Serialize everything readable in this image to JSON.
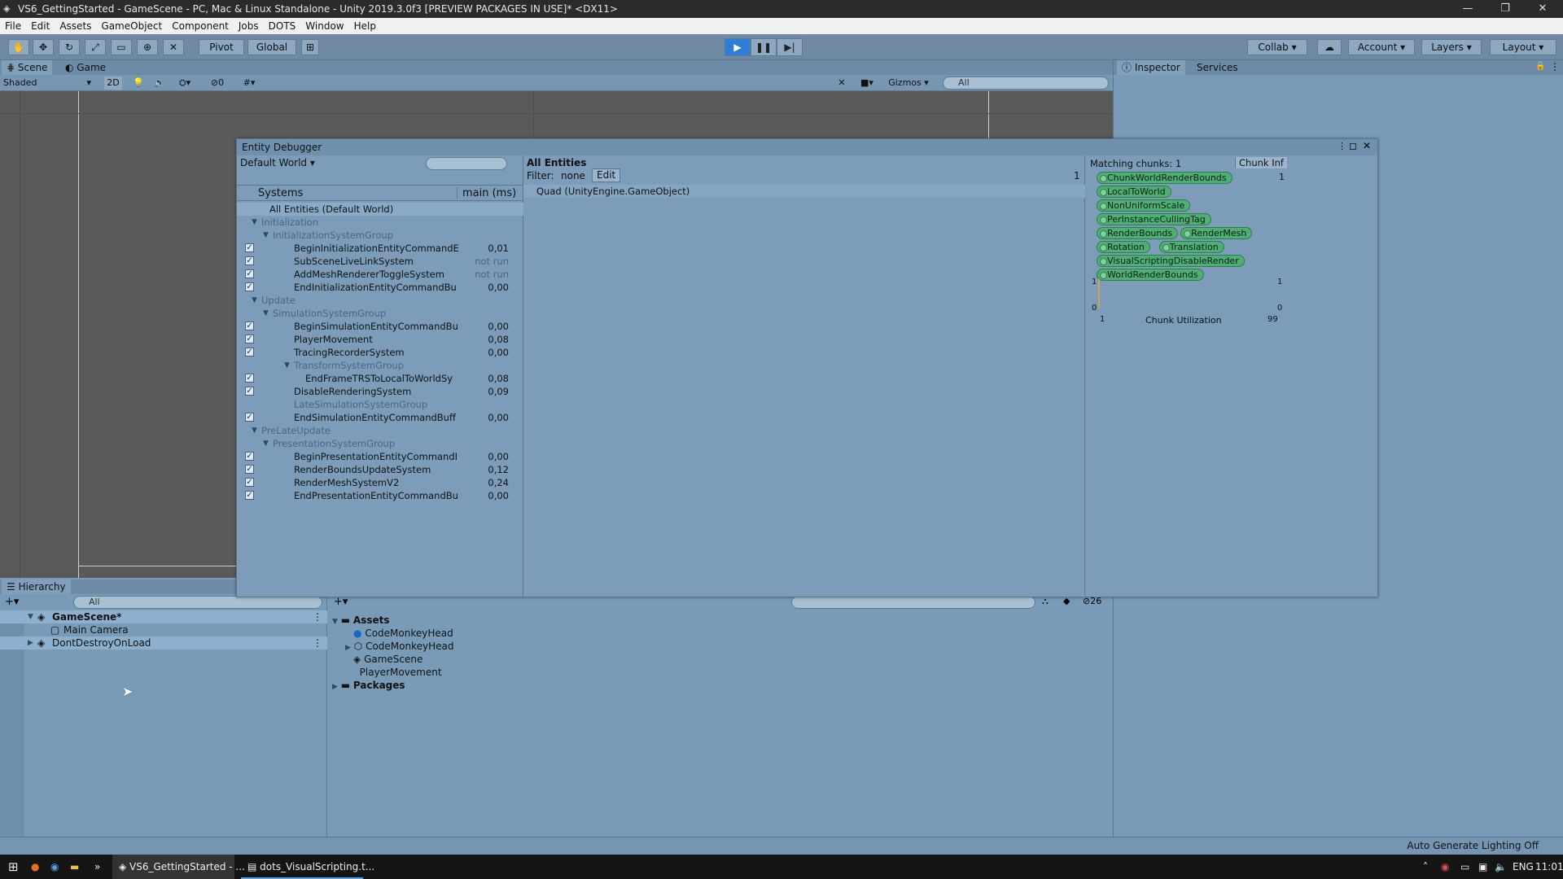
{
  "window": {
    "title": "VS6_GettingStarted - GameScene - PC, Mac & Linux Standalone - Unity 2019.3.0f3 [PREVIEW PACKAGES IN USE]* <DX11>",
    "minimize": "—",
    "maximize": "❐",
    "close": "✕"
  },
  "menu": [
    "File",
    "Edit",
    "Assets",
    "GameObject",
    "Component",
    "Jobs",
    "DOTS",
    "Window",
    "Help"
  ],
  "toolbar": {
    "pivot": "Pivot",
    "global": "Global",
    "collab": "Collab",
    "account": "Account",
    "layers": "Layers",
    "layout": "Layout"
  },
  "scene_tabs": {
    "scene": "Scene",
    "game": "Game"
  },
  "scene_bar": {
    "shading": "Shaded",
    "mode_2d": "2D",
    "hidden_count": "0",
    "gizmos": "Gizmos",
    "search_placeholder": "All"
  },
  "inspector_tabs": {
    "inspector": "Inspector",
    "services": "Services"
  },
  "entity_debugger": {
    "title": "Entity Debugger",
    "world": "Default World",
    "systems_header": "Systems",
    "main_ms_header": "main (ms)",
    "all_entities_row": "All Entities (Default World)",
    "systems": [
      {
        "name": "Initialization",
        "level": 1,
        "type": "group",
        "ms": ""
      },
      {
        "name": "InitializationSystemGroup",
        "level": 2,
        "type": "group",
        "ms": ""
      },
      {
        "name": "BeginInitializationEntityCommandE",
        "level": 3,
        "type": "system",
        "ms": "0,01"
      },
      {
        "name": "SubSceneLiveLinkSystem",
        "level": 3,
        "type": "system",
        "ms": "not run"
      },
      {
        "name": "AddMeshRendererToggleSystem",
        "level": 3,
        "type": "system",
        "ms": "not run"
      },
      {
        "name": "EndInitializationEntityCommandBu",
        "level": 3,
        "type": "system",
        "ms": "0,00"
      },
      {
        "name": "Update",
        "level": 1,
        "type": "group",
        "ms": ""
      },
      {
        "name": "SimulationSystemGroup",
        "level": 2,
        "type": "group",
        "ms": ""
      },
      {
        "name": "BeginSimulationEntityCommandBu",
        "level": 3,
        "type": "system",
        "ms": "0,00"
      },
      {
        "name": "PlayerMovement",
        "level": 3,
        "type": "system",
        "ms": "0,08"
      },
      {
        "name": "TracingRecorderSystem",
        "level": 3,
        "type": "system",
        "ms": "0,00"
      },
      {
        "name": "TransformSystemGroup",
        "level": 3,
        "type": "group",
        "ms": ""
      },
      {
        "name": "EndFrameTRSToLocalToWorldSy",
        "level": 4,
        "type": "system",
        "ms": "0,08"
      },
      {
        "name": "DisableRenderingSystem",
        "level": 3,
        "type": "system",
        "ms": "0,09"
      },
      {
        "name": "LateSimulationSystemGroup",
        "level": 3,
        "type": "empty",
        "ms": ""
      },
      {
        "name": "EndSimulationEntityCommandBuff",
        "level": 3,
        "type": "system",
        "ms": "0,00"
      },
      {
        "name": "PreLateUpdate",
        "level": 1,
        "type": "group",
        "ms": ""
      },
      {
        "name": "PresentationSystemGroup",
        "level": 2,
        "type": "group",
        "ms": ""
      },
      {
        "name": "BeginPresentationEntityCommandI",
        "level": 3,
        "type": "system",
        "ms": "0,00"
      },
      {
        "name": "RenderBoundsUpdateSystem",
        "level": 3,
        "type": "system",
        "ms": "0,12"
      },
      {
        "name": "RenderMeshSystemV2",
        "level": 3,
        "type": "system",
        "ms": "0,24"
      },
      {
        "name": "EndPresentationEntityCommandBu",
        "level": 3,
        "type": "system",
        "ms": "0,00"
      }
    ],
    "entities": {
      "header": "All Entities",
      "filter_label": "Filter:",
      "filter_value": "none",
      "edit_button": "Edit",
      "count": "1",
      "items": [
        "Quad (UnityEngine.GameObject)"
      ]
    },
    "chunks": {
      "matching": "Matching chunks: 1",
      "chunk_info_tab": "Chunk Inf",
      "count": "1",
      "components": [
        "ChunkWorldRenderBounds",
        "LocalToWorld",
        "NonUniformScale",
        "PerInstanceCullingTag",
        "RenderBounds",
        "RenderMesh",
        "Rotation",
        "Translation",
        "VisualScriptingDisableRender",
        "WorldRenderBounds"
      ],
      "graph": {
        "y_top": "1",
        "y_bottom": "0",
        "y_top_right": "1",
        "y_bottom_right": "0",
        "x_left": "1",
        "x_right": "99",
        "label": "Chunk Utilization"
      }
    }
  },
  "hierarchy": {
    "tab": "Hierarchy",
    "search_placeholder": "All",
    "items": [
      {
        "name": "GameScene*",
        "level": 0,
        "expanded": true
      },
      {
        "name": "Main Camera",
        "level": 1
      },
      {
        "name": "DontDestroyOnLoad",
        "level": 0,
        "expanded": false
      }
    ]
  },
  "project": {
    "hidden_count": "26",
    "tree": [
      {
        "name": "Assets",
        "level": 0,
        "folder": true,
        "bold": true
      },
      {
        "name": "CodeMonkeyHead",
        "level": 1,
        "kind": "material"
      },
      {
        "name": "CodeMonkeyHead",
        "level": 1,
        "kind": "prefab"
      },
      {
        "name": "GameScene",
        "level": 1,
        "kind": "scene"
      },
      {
        "name": "PlayerMovement",
        "level": 1,
        "kind": "script"
      },
      {
        "name": "Packages",
        "level": 0,
        "folder": true,
        "bold": true
      }
    ]
  },
  "status_bar": {
    "right": "Auto Generate Lighting Off"
  },
  "taskbar": {
    "items": [
      "VS6_GettingStarted - ...",
      "dots_VisualScripting.t..."
    ],
    "lang": "ENG",
    "time": "11:01"
  },
  "colors": {
    "accent_play": "#2e7ed8",
    "chip_green": "#4fae73",
    "panel": "#7a9bb8"
  }
}
